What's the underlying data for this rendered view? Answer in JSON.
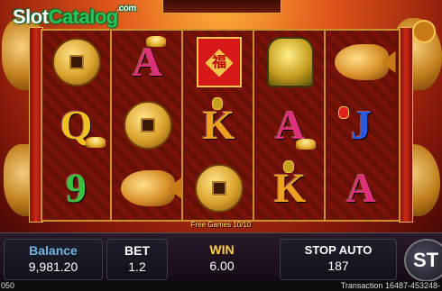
{
  "watermark": {
    "slot": "Slot",
    "catalog": "Catalog",
    "com": ".com"
  },
  "title": "",
  "reels": [
    [
      "coin",
      "Q",
      "9"
    ],
    [
      "A",
      "coin",
      "koi"
    ],
    [
      "envelope",
      "K",
      "coin"
    ],
    [
      "foo-dog",
      "A",
      "K"
    ],
    [
      "koi",
      "J",
      "A"
    ]
  ],
  "free_games_text": "Free Games 10/10",
  "bottom_bar": {
    "balance_label": "Balance",
    "balance_value": "9,981.20",
    "bet_label": "BET",
    "bet_value": "1.2",
    "win_label": "WIN",
    "win_value": "6.00",
    "stop_auto_label": "STOP AUTO",
    "stop_auto_value": "187",
    "spin_label": "ST"
  },
  "footer": {
    "left_text": "050",
    "transaction_text": "Transaction 16487-453248-"
  },
  "colors": {
    "balance_label": "#6fb5e0",
    "win_label": "#ffd23a",
    "letter_A": "#e0307a",
    "letter_K": "#f0a020",
    "letter_Q": "#f0c020",
    "letter_J": "#2a5ae0",
    "letter_9": "#3cc040"
  }
}
